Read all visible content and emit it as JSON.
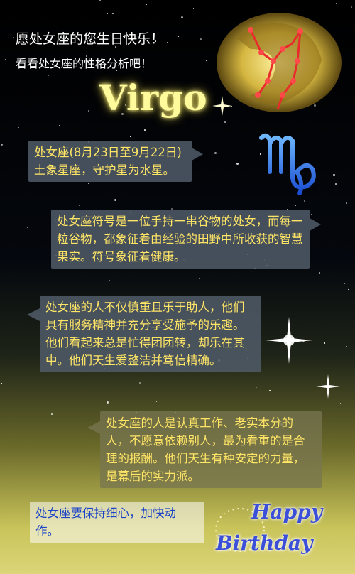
{
  "header": {
    "greeting": "愿处女座的您生日快乐！",
    "subtitle": "看看处女座的性格分析吧！",
    "virgo_title": "Virgo"
  },
  "bubbles": [
    "处女座(8月23日至9月22日)土象星座，守护星为水星。",
    "处女座符号是一位手持一串谷物的处女，而每一粒谷物，都象征着由经验的田野中所收获的智慧果实。符号象征着健康。",
    "处女座的人不仅慎重且乐于助人，他们具有服务精神并充分享受施予的乐趣。他们看起来总是忙得团团转，却乐在其中。他们天生爱整洁并笃信精确。",
    "处女座的人是认真工作、老实本分的人，不愿意依赖别人，最为看重的是合理的报酬。他们天生有种安定的力量，是幕后的实力派。",
    "处女座要保持细心，加快动作。"
  ],
  "footer": {
    "happy": "Happy",
    "birthday": "Birthday"
  },
  "colors": {
    "bubble_text": "#ffe566",
    "virgo_glow": "#fffa9c",
    "symbol_blue": "#2a6ff0",
    "happy_blue": "#3b4fd9"
  },
  "icons": [
    "virgo-constellation-icon",
    "virgo-zodiac-symbol-icon",
    "sparkle-icon"
  ]
}
